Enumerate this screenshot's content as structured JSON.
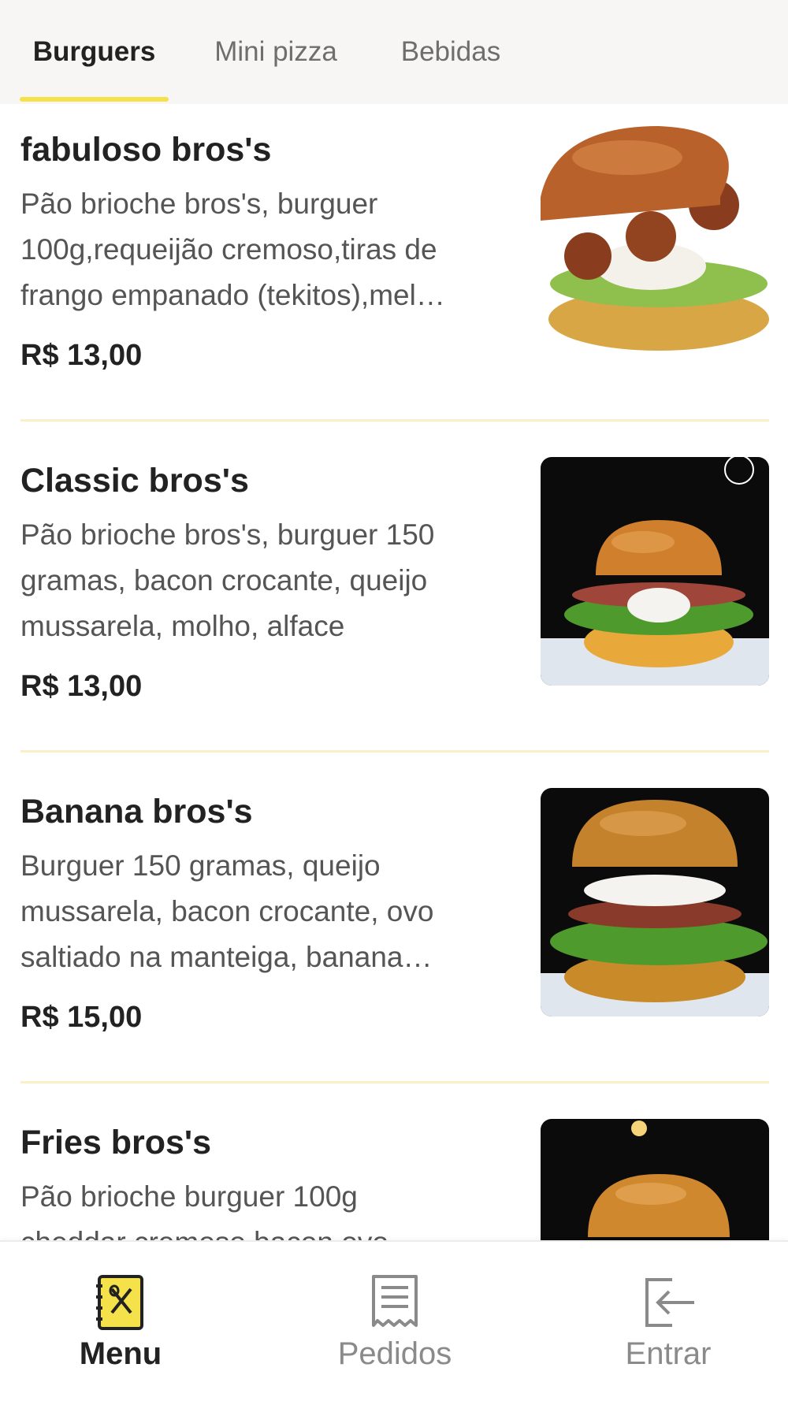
{
  "colors": {
    "accent": "#f5e14a",
    "divider": "#fbefc7",
    "tab_background": "#f7f6f4",
    "text_primary": "#222222",
    "text_secondary": "#555555",
    "nav_inactive": "#8a8a8a"
  },
  "tabs": [
    {
      "label": "Burguers",
      "active": true
    },
    {
      "label": "Mini pizza",
      "active": false
    },
    {
      "label": "Bebidas",
      "active": false
    }
  ],
  "products": [
    {
      "name": "fabuloso bros's",
      "description_lines": [
        "Pão brioche bros's, burguer",
        "100g,requeijão cremoso,tiras de",
        "frango empanado (tekitos),mel…"
      ],
      "price": "R$ 13,00",
      "image": "burger-photo"
    },
    {
      "name": "Classic bros's",
      "description_lines": [
        "Pão brioche bros's, burguer 150",
        "gramas, bacon crocante, queijo",
        "mussarela, molho, alface"
      ],
      "price": "R$ 13,00",
      "image": "burger-photo"
    },
    {
      "name": "Banana bros's",
      "description_lines": [
        "Burguer 150 gramas, queijo",
        "mussarela, bacon crocante, ovo",
        "saltiado na manteiga, banana…"
      ],
      "price": "R$ 15,00",
      "image": "burger-photo"
    },
    {
      "name": "Fries bros's",
      "description_lines": [
        "Pão brioche burguer 100g",
        "cheddar cremoso bacon ovo"
      ],
      "price": "",
      "image": "burger-photo"
    }
  ],
  "bottom_nav": [
    {
      "label": "Menu",
      "icon": "menu-book-icon",
      "active": true
    },
    {
      "label": "Pedidos",
      "icon": "receipt-icon",
      "active": false
    },
    {
      "label": "Entrar",
      "icon": "login-icon",
      "active": false
    }
  ]
}
